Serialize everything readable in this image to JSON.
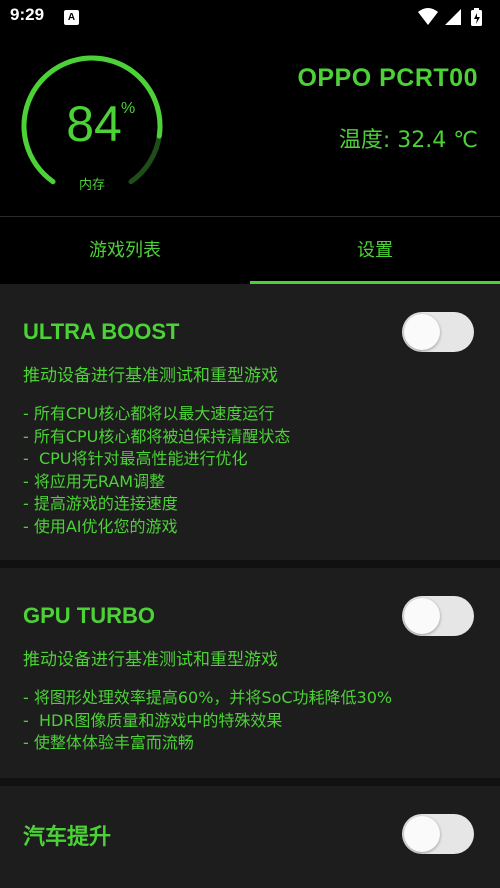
{
  "status_bar": {
    "time": "9:29",
    "notification_icon": "A"
  },
  "header": {
    "memory_percent": 84,
    "memory_value": "84",
    "memory_unit": "%",
    "memory_label": "内存",
    "device_name": "OPPO PCRT00",
    "temperature": "温度: 32.4 ℃"
  },
  "tabs": [
    {
      "label": "游戏列表",
      "selected": false
    },
    {
      "label": "设置",
      "selected": true
    }
  ],
  "cards": [
    {
      "title": "ULTRA BOOST",
      "description": "推动设备进行基准测试和重型游戏",
      "enabled": false,
      "items": [
        "- 所有CPU核心都将以最大速度运行",
        "- 所有CPU核心都将被迫保持清醒状态",
        "-  CPU将针对最高性能进行优化",
        "- 将应用无RAM调整",
        "- 提高游戏的连接速度",
        "- 使用AI优化您的游戏"
      ]
    },
    {
      "title": "GPU TURBO",
      "description": "推动设备进行基准测试和重型游戏",
      "enabled": false,
      "items": [
        "- 将图形处理效率提高60%，并将SoC功耗降低30%",
        "-  HDR图像质量和游戏中的特殊效果",
        "- 使整体体验丰富而流畅"
      ]
    },
    {
      "title": "汽车提升",
      "enabled": false
    }
  ],
  "colors": {
    "accent": "#4cd137",
    "background": "#111111",
    "card": "#1d1d1d",
    "header": "#000000"
  }
}
